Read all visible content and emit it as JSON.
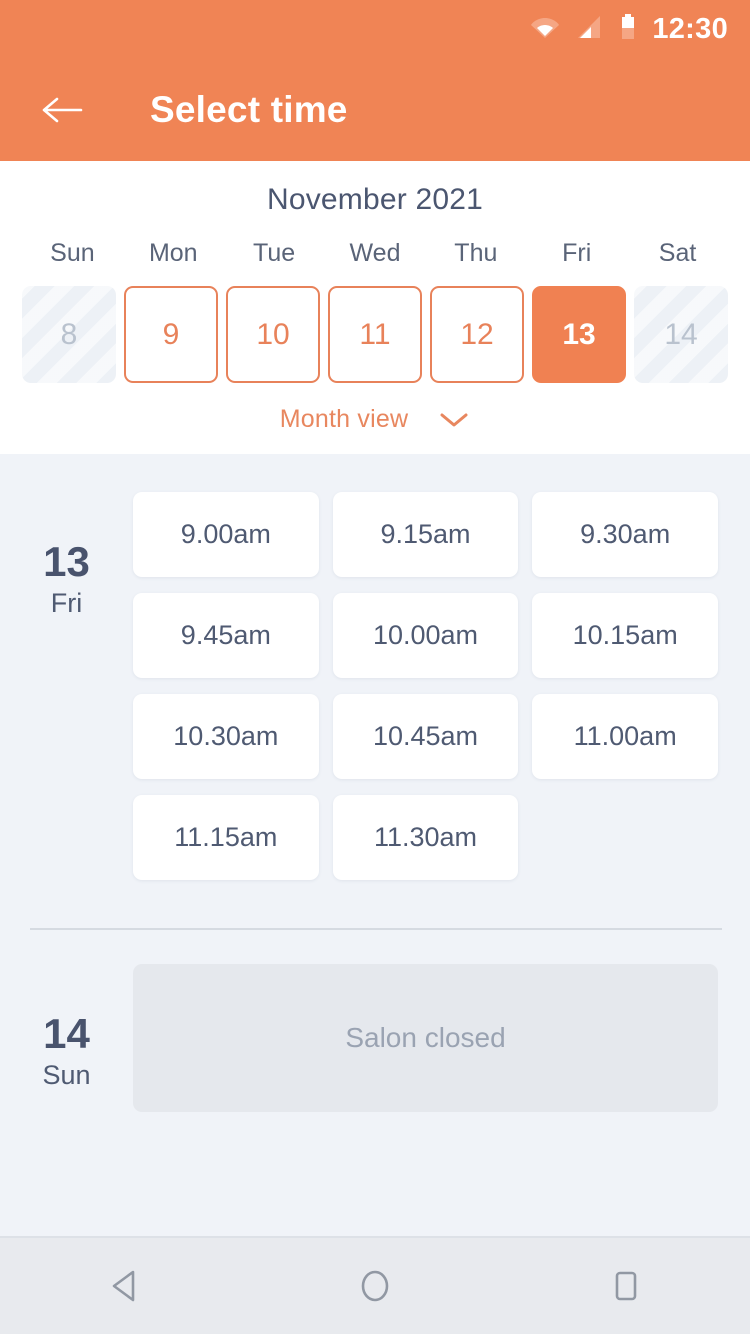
{
  "status_bar": {
    "time": "12:30",
    "icons": [
      "wifi-icon",
      "signal-icon",
      "battery-icon"
    ]
  },
  "app_bar": {
    "title": "Select time",
    "back_icon": "back-arrow-icon"
  },
  "calendar": {
    "month_label": "November 2021",
    "weekdays": [
      "Sun",
      "Mon",
      "Tue",
      "Wed",
      "Thu",
      "Fri",
      "Sat"
    ],
    "days": [
      {
        "number": "8",
        "state": "disabled"
      },
      {
        "number": "9",
        "state": "available"
      },
      {
        "number": "10",
        "state": "available"
      },
      {
        "number": "11",
        "state": "available"
      },
      {
        "number": "12",
        "state": "available"
      },
      {
        "number": "13",
        "state": "selected"
      },
      {
        "number": "14",
        "state": "disabled"
      }
    ],
    "month_view_label": "Month view",
    "chevron_icon": "chevron-down-icon"
  },
  "schedule": [
    {
      "day_number": "13",
      "day_of_week": "Fri",
      "slots": [
        "9.00am",
        "9.15am",
        "9.30am",
        "9.45am",
        "10.00am",
        "10.15am",
        "10.30am",
        "10.45am",
        "11.00am",
        "11.15am",
        "11.30am"
      ]
    },
    {
      "day_number": "14",
      "day_of_week": "Sun",
      "closed_label": "Salon closed"
    }
  ],
  "nav_bar": {
    "back_icon": "triangle-back-icon",
    "home_icon": "circle-home-icon",
    "recents_icon": "square-recents-icon"
  },
  "colors": {
    "accent": "#F08455",
    "accent_border": "#E8825A",
    "text_dark": "#4B5670",
    "background": "#F0F3F8",
    "panel": "#FFFFFF",
    "disabled_text": "#B9C2CE",
    "closed_card": "#E5E8ED"
  }
}
